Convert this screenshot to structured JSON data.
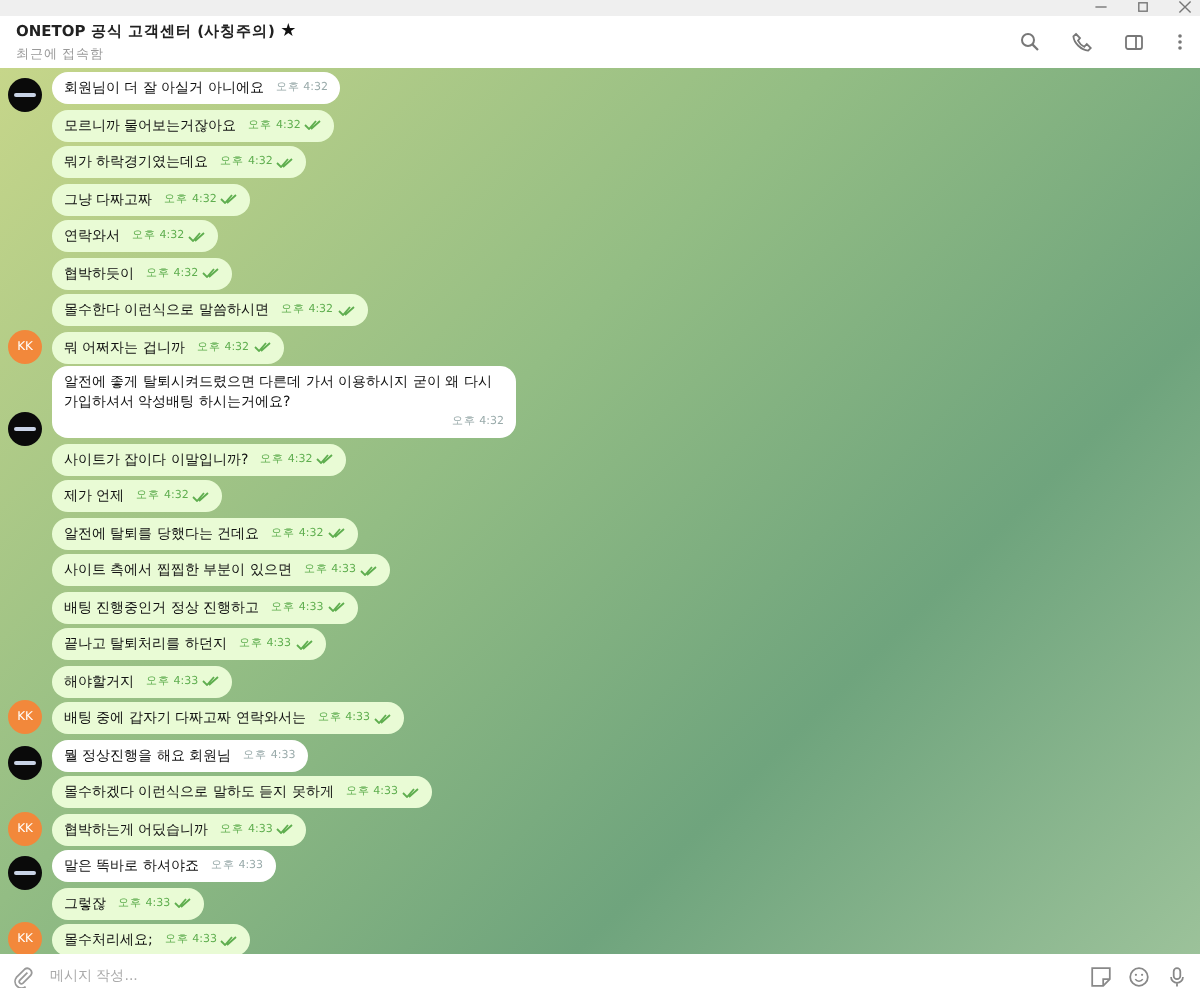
{
  "header": {
    "title": "ONETOP 공식 고객센터 (사칭주의)",
    "title_mark": "★",
    "subtitle": "최근에 접속함"
  },
  "messages": [
    {
      "kind": "in",
      "text": "회원님이 더 잘 아실거 아니에요",
      "time": "오후 4:32",
      "avatar": true
    },
    {
      "kind": "out",
      "text": "모르니까 물어보는거잖아요",
      "time": "오후 4:32",
      "avatar": false
    },
    {
      "kind": "out",
      "text": "뭐가 하락경기였는데요",
      "time": "오후 4:32",
      "avatar": false
    },
    {
      "kind": "out",
      "text": "그냥 다짜고짜",
      "time": "오후 4:32",
      "avatar": false
    },
    {
      "kind": "out",
      "text": "연락와서",
      "time": "오후 4:32",
      "avatar": false
    },
    {
      "kind": "out",
      "text": "협박하듯이",
      "time": "오후 4:32",
      "avatar": false
    },
    {
      "kind": "out",
      "text": "몰수한다 이런식으로 말씀하시면",
      "time": "오후 4:32",
      "avatar": false
    },
    {
      "kind": "out",
      "text": "뭐 어쩌자는 겁니까",
      "time": "오후 4:32",
      "avatar": true,
      "avatar_text": "KK"
    },
    {
      "kind": "in",
      "text": "알전에 좋게 탈퇴시켜드렸으면 다른데 가서 이용하시지 굳이 왜 다시 가입하셔서 악성배팅 하시는거에요?",
      "time": "오후 4:32",
      "avatar": true
    },
    {
      "kind": "out",
      "text": "사이트가 잡이다 이말입니까?",
      "time": "오후 4:32",
      "avatar": false
    },
    {
      "kind": "out",
      "text": "제가 언제",
      "time": "오후 4:32",
      "avatar": false
    },
    {
      "kind": "out",
      "text": "알전에 탈퇴를 당했다는 건데요",
      "time": "오후 4:32",
      "avatar": false
    },
    {
      "kind": "out",
      "text": "사이트 측에서 찝찝한 부분이 있으면",
      "time": "오후 4:33",
      "avatar": false
    },
    {
      "kind": "out",
      "text": "배팅 진행중인거 정상 진행하고",
      "time": "오후 4:33",
      "avatar": false
    },
    {
      "kind": "out",
      "text": "끝나고 탈퇴처리를 하던지",
      "time": "오후 4:33",
      "avatar": false
    },
    {
      "kind": "out",
      "text": "해야할거지",
      "time": "오후 4:33",
      "avatar": false
    },
    {
      "kind": "out",
      "text": "배팅 중에 갑자기 다짜고짜 연락와서는",
      "time": "오후 4:33",
      "avatar": true,
      "avatar_text": "KK"
    },
    {
      "kind": "in",
      "text": "뭘 정상진행을 해요 회원님",
      "time": "오후 4:33",
      "avatar": true
    },
    {
      "kind": "out",
      "text": "몰수하겠다 이런식으로 말하도 듣지 못하게",
      "time": "오후 4:33",
      "avatar": false
    },
    {
      "kind": "out",
      "text": "협박하는게 어딨습니까",
      "time": "오후 4:33",
      "avatar": true,
      "avatar_text": "KK"
    },
    {
      "kind": "in",
      "text": "말은 똑바로 하셔야죠",
      "time": "오후 4:33",
      "avatar": true
    },
    {
      "kind": "out",
      "text": "그렇잖",
      "time": "오후 4:33",
      "avatar": false
    },
    {
      "kind": "out",
      "text": "몰수처리세요;",
      "time": "오후 4:33",
      "avatar": true,
      "avatar_text": "KK"
    }
  ],
  "composer": {
    "placeholder": "메시지 작성..."
  }
}
